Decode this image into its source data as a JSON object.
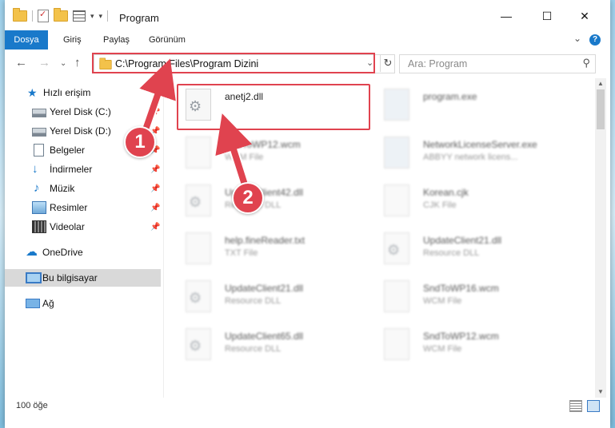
{
  "window": {
    "title": "Program",
    "controls": {
      "minimize": "—",
      "maximize": "☐",
      "close": "✕"
    }
  },
  "ribbon": {
    "tabs": [
      "Dosya",
      "Giriş",
      "Paylaş",
      "Görünüm"
    ],
    "help": "?"
  },
  "navigation": {
    "address": "C:\\Program Files\\Program Dizini",
    "search_placeholder": "Ara: Program"
  },
  "sidebar": {
    "quick_access": "Hızlı erişim",
    "items": [
      {
        "label": "Yerel Disk (C:)",
        "icon": "drive-icon",
        "pinned": true
      },
      {
        "label": "Yerel Disk (D:)",
        "icon": "drive-icon",
        "pinned": true
      },
      {
        "label": "Belgeler",
        "icon": "documents-icon",
        "pinned": true
      },
      {
        "label": "İndirmeler",
        "icon": "downloads-icon",
        "pinned": true
      },
      {
        "label": "Müzik",
        "icon": "music-icon",
        "pinned": true
      },
      {
        "label": "Resimler",
        "icon": "pictures-icon",
        "pinned": true
      },
      {
        "label": "Videolar",
        "icon": "videos-icon",
        "pinned": true
      }
    ],
    "onedrive": "OneDrive",
    "this_pc": "Bu bilgisayar",
    "network": "Ağ"
  },
  "files": [
    {
      "name": "anetj2.dll",
      "type": "",
      "icon": "dll-file-icon"
    },
    {
      "name": "program.exe",
      "type": "",
      "icon": "exe-file-icon"
    },
    {
      "name": "SndToWP12.wcm",
      "type": "WCM File",
      "icon": "file-icon"
    },
    {
      "name": "NetworkLicenseServer.exe",
      "type": "ABBYY network licens...",
      "icon": "exe-file-icon"
    },
    {
      "name": "UpdateClient42.dll",
      "type": "Resource DLL",
      "icon": "dll-file-icon"
    },
    {
      "name": "Korean.cjk",
      "type": "CJK File",
      "icon": "file-icon"
    },
    {
      "name": "help.fineReader.txt",
      "type": "TXT File",
      "icon": "file-icon"
    },
    {
      "name": "UpdateClient21.dll",
      "type": "Resource DLL",
      "icon": "dll-file-icon"
    },
    {
      "name": "UpdateClient21.dll",
      "type": "Resource DLL",
      "icon": "dll-file-icon"
    },
    {
      "name": "SndToWP16.wcm",
      "type": "WCM File",
      "icon": "file-icon"
    },
    {
      "name": "UpdateClient65.dll",
      "type": "Resource DLL",
      "icon": "dll-file-icon"
    },
    {
      "name": "SndToWP12.wcm",
      "type": "WCM File",
      "icon": "file-icon"
    }
  ],
  "status": {
    "item_count": "100 öğe"
  },
  "annotations": {
    "step1": "1",
    "step2": "2",
    "color": "#e0434f"
  }
}
